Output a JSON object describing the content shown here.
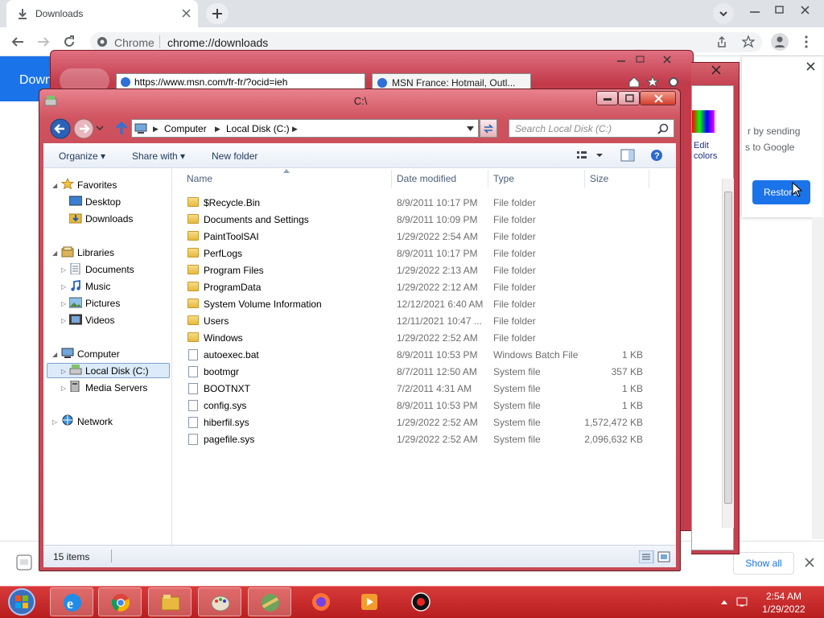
{
  "chrome": {
    "tab_title": "Downloads",
    "omnibox_site": "Chrome",
    "omnibox_url": "chrome://downloads",
    "banner_text": "Downlo",
    "popup_line1": "r by sending",
    "popup_line2": "s to Google",
    "restore_button": "Restore",
    "show_all": "Show all"
  },
  "ie": {
    "address": "https://www.msn.com/fr-fr/?ocid=ieh",
    "tab_title": "MSN France: Hotmail, Outl..."
  },
  "side_panel": {
    "edit_colors": "Edit colors"
  },
  "explorer": {
    "title": "C:\\",
    "breadcrumb": [
      "Computer",
      "Local Disk (C:)"
    ],
    "search_placeholder": "Search Local Disk (C:)",
    "toolbar": {
      "organize": "Organize",
      "share_with": "Share with",
      "new_folder": "New folder"
    },
    "nav": {
      "favorites": "Favorites",
      "desktop": "Desktop",
      "downloads": "Downloads",
      "libraries": "Libraries",
      "documents": "Documents",
      "music": "Music",
      "pictures": "Pictures",
      "videos": "Videos",
      "computer": "Computer",
      "local_disk": "Local Disk (C:)",
      "media_servers": "Media Servers",
      "network": "Network"
    },
    "columns": [
      "Name",
      "Date modified",
      "Type",
      "Size"
    ],
    "files": [
      {
        "name": "$Recycle.Bin",
        "date": "8/9/2011 10:17 PM",
        "type": "File folder",
        "size": "",
        "icon": "folder-icon"
      },
      {
        "name": "Documents and Settings",
        "date": "8/9/2011 10:09 PM",
        "type": "File folder",
        "size": "",
        "icon": "shortcut-folder-icon"
      },
      {
        "name": "PaintToolSAI",
        "date": "1/29/2022 2:54 AM",
        "type": "File folder",
        "size": "",
        "icon": "folder-icon"
      },
      {
        "name": "PerfLogs",
        "date": "8/9/2011 10:17 PM",
        "type": "File folder",
        "size": "",
        "icon": "folder-icon"
      },
      {
        "name": "Program Files",
        "date": "1/29/2022 2:13 AM",
        "type": "File folder",
        "size": "",
        "icon": "folder-icon"
      },
      {
        "name": "ProgramData",
        "date": "1/29/2022 2:12 AM",
        "type": "File folder",
        "size": "",
        "icon": "folder-icon"
      },
      {
        "name": "System Volume Information",
        "date": "12/12/2021 6:40 AM",
        "type": "File folder",
        "size": "",
        "icon": "folder-icon"
      },
      {
        "name": "Users",
        "date": "12/11/2021 10:47 ...",
        "type": "File folder",
        "size": "",
        "icon": "folder-icon"
      },
      {
        "name": "Windows",
        "date": "1/29/2022 2:52 AM",
        "type": "File folder",
        "size": "",
        "icon": "folder-icon"
      },
      {
        "name": "autoexec.bat",
        "date": "8/9/2011 10:53 PM",
        "type": "Windows Batch File",
        "size": "1 KB",
        "icon": "batch-file-icon"
      },
      {
        "name": "bootmgr",
        "date": "8/7/2011 12:50 AM",
        "type": "System file",
        "size": "357 KB",
        "icon": "system-file-icon"
      },
      {
        "name": "BOOTNXT",
        "date": "7/2/2011 4:31 AM",
        "type": "System file",
        "size": "1 KB",
        "icon": "system-file-icon"
      },
      {
        "name": "config.sys",
        "date": "8/9/2011 10:53 PM",
        "type": "System file",
        "size": "1 KB",
        "icon": "system-file-icon"
      },
      {
        "name": "hiberfil.sys",
        "date": "1/29/2022 2:52 AM",
        "type": "System file",
        "size": "1,572,472 KB",
        "icon": "system-file-icon"
      },
      {
        "name": "pagefile.sys",
        "date": "1/29/2022 2:52 AM",
        "type": "System file",
        "size": "2,096,632 KB",
        "icon": "system-file-icon"
      }
    ],
    "status": "15 items"
  },
  "taskbar": {
    "time": "2:54 AM",
    "date": "1/29/2022",
    "apps": [
      "internet-explorer-icon",
      "chrome-icon",
      "file-explorer-icon",
      "paint-icon",
      "paint-tool-sai-icon",
      "firefox-icon",
      "media-player-icon",
      "recorder-icon"
    ]
  },
  "colors": {
    "window_frame": "#c64956",
    "taskbar": "#c82828",
    "chrome_blue": "#1a73e8",
    "selection": "#dceaf9"
  }
}
